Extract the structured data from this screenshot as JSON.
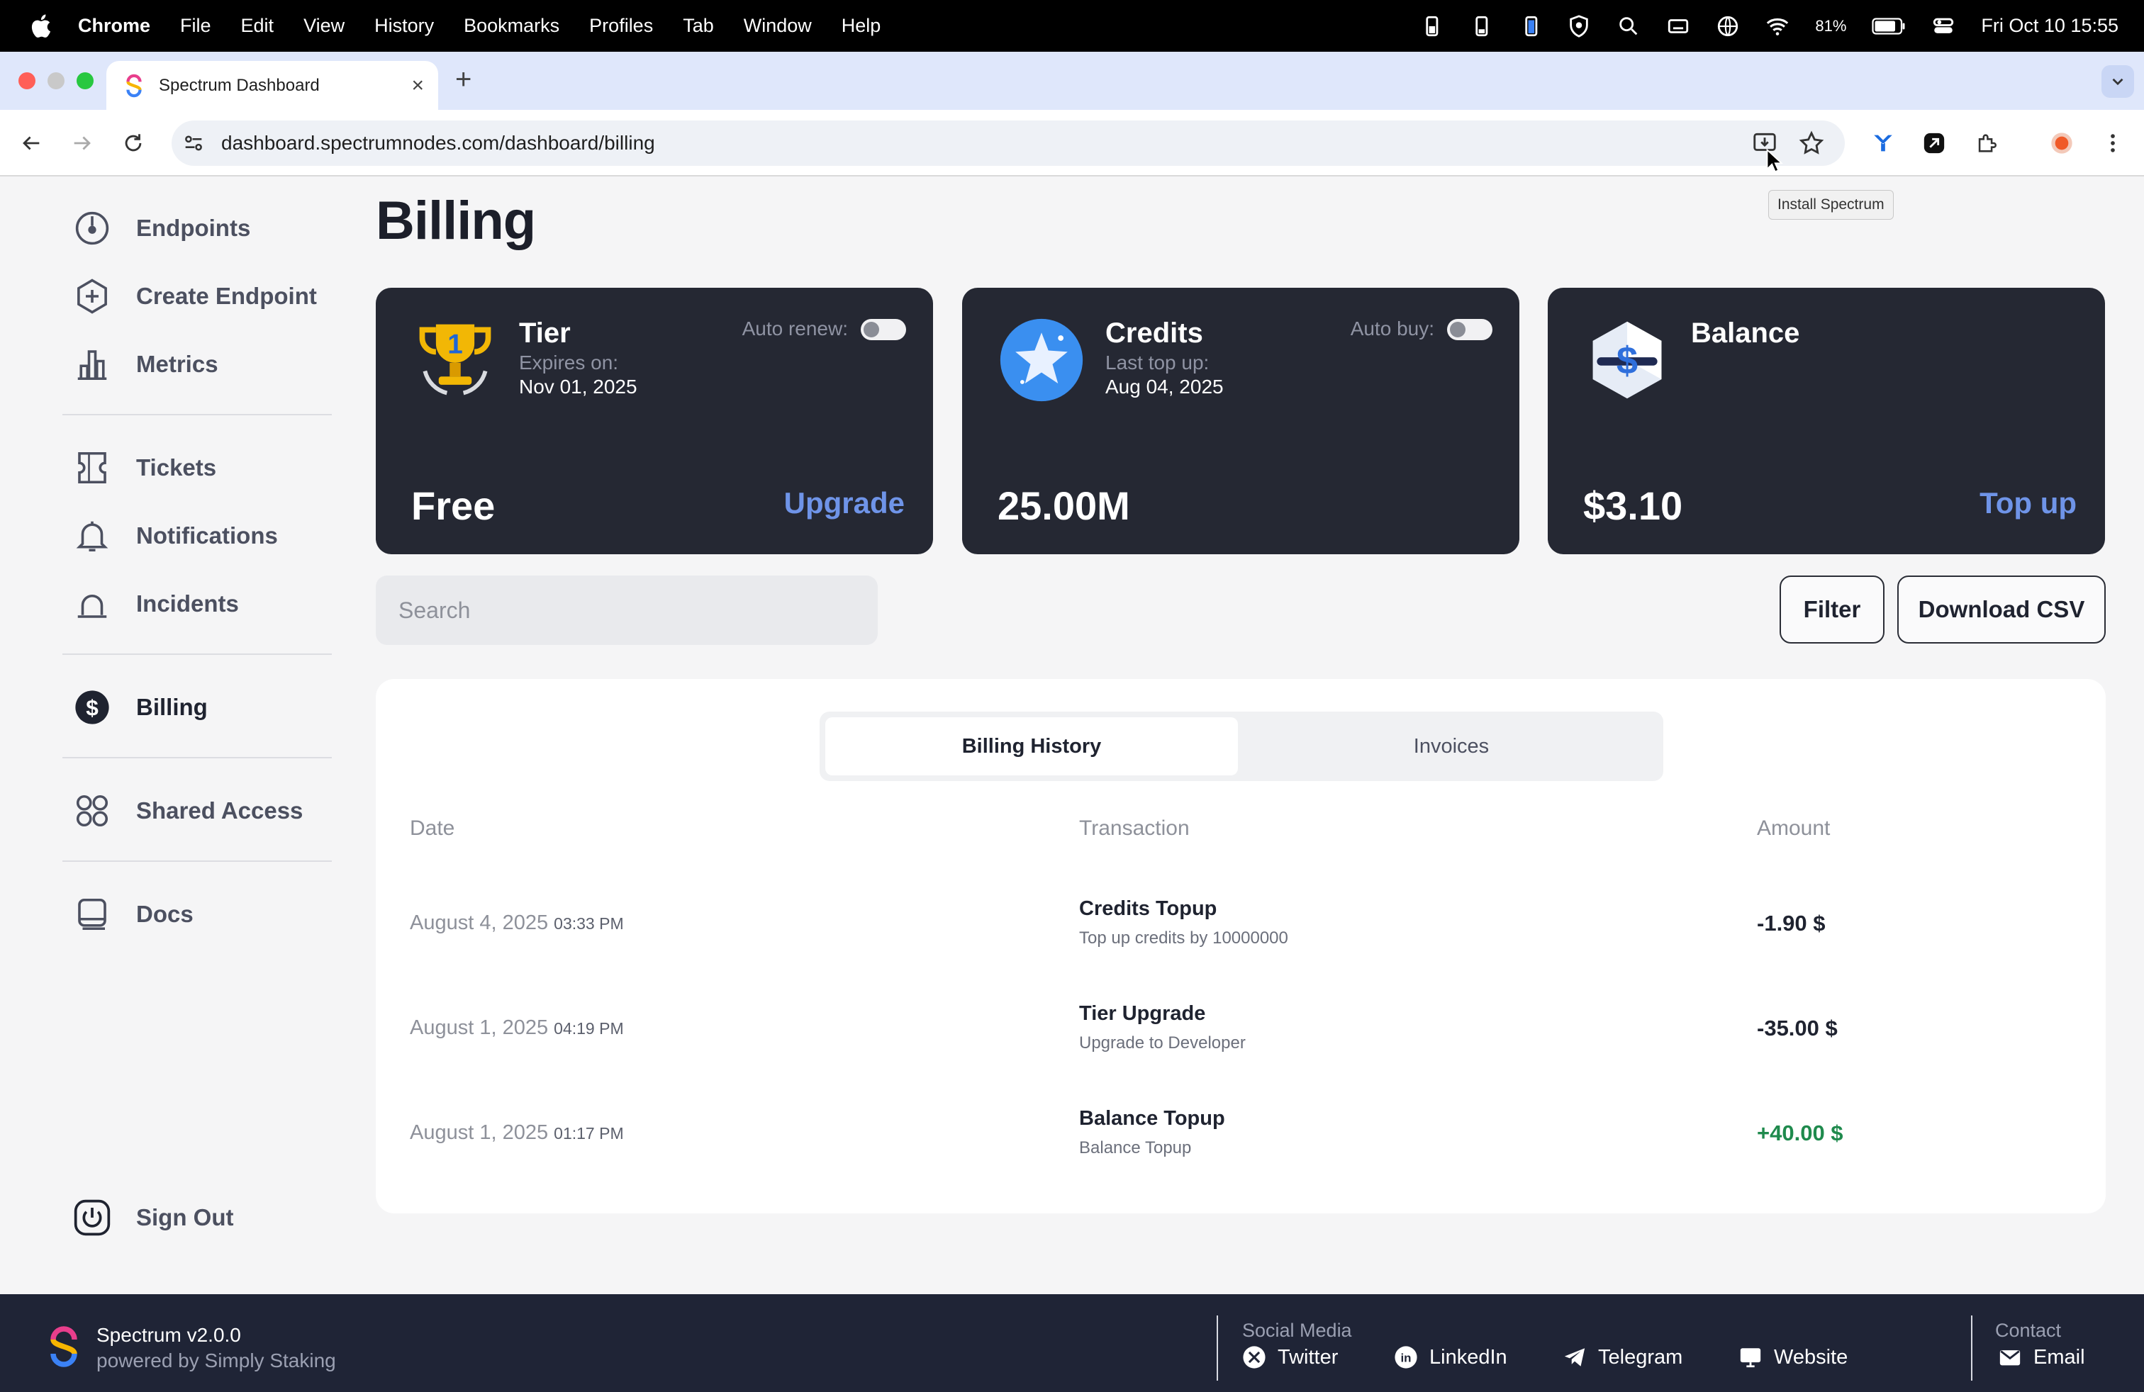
{
  "menubar": {
    "app": "Chrome",
    "items": [
      "File",
      "Edit",
      "View",
      "History",
      "Bookmarks",
      "Profiles",
      "Tab",
      "Window",
      "Help"
    ],
    "battery": "81%",
    "clock": "Fri Oct 10  15:55"
  },
  "browser": {
    "tab_title": "Spectrum Dashboard",
    "url": "dashboard.spectrumnodes.com/dashboard/billing",
    "tooltip": "Install Spectrum"
  },
  "sidebar": {
    "items": [
      {
        "label": "Endpoints",
        "icon": "gauge-icon"
      },
      {
        "label": "Create Endpoint",
        "icon": "plus-hexagon-icon"
      },
      {
        "label": "Metrics",
        "icon": "bar-chart-icon"
      },
      {
        "label": "Tickets",
        "icon": "ticket-icon"
      },
      {
        "label": "Notifications",
        "icon": "bell-icon"
      },
      {
        "label": "Incidents",
        "icon": "alarm-icon"
      },
      {
        "label": "Billing",
        "icon": "dollar-icon"
      },
      {
        "label": "Shared Access",
        "icon": "grid-circles-icon"
      },
      {
        "label": "Docs",
        "icon": "book-icon"
      }
    ],
    "signout": "Sign Out"
  },
  "page": {
    "title": "Billing"
  },
  "cards": {
    "tier": {
      "title": "Tier",
      "sub": "Expires on:",
      "date": "Nov 01, 2025",
      "toggle_label": "Auto renew:",
      "value": "Free",
      "action": "Upgrade"
    },
    "credits": {
      "title": "Credits",
      "sub": "Last top up:",
      "date": "Aug 04, 2025",
      "toggle_label": "Auto buy:",
      "value": "25.00M"
    },
    "balance": {
      "title": "Balance",
      "value": "$3.10",
      "action": "Top up"
    }
  },
  "toolbar": {
    "search_placeholder": "Search",
    "filter": "Filter",
    "download": "Download CSV"
  },
  "history": {
    "tabs": [
      "Billing History",
      "Invoices"
    ],
    "columns": [
      "Date",
      "Transaction",
      "Amount"
    ],
    "rows": [
      {
        "date": "August 4, 2025",
        "time": "03:33 PM",
        "title": "Credits Topup",
        "desc": "Top up credits by 10000000",
        "amount": "-1.90 $"
      },
      {
        "date": "August 1, 2025",
        "time": "04:19 PM",
        "title": "Tier Upgrade",
        "desc": "Upgrade to Developer",
        "amount": "-35.00 $"
      },
      {
        "date": "August 1, 2025",
        "time": "01:17 PM",
        "title": "Balance Topup",
        "desc": "Balance Topup",
        "amount": "+40.00 $"
      }
    ]
  },
  "footer": {
    "name": "Spectrum v2.0.0",
    "powered": "powered by Simply Staking",
    "social_heading": "Social Media",
    "social": [
      "Twitter",
      "LinkedIn",
      "Telegram",
      "Website"
    ],
    "contact_heading": "Contact",
    "contact": "Email"
  },
  "colors": {
    "card_bg": "#252833",
    "accent_link": "#6f94e8",
    "positive": "#1f8a4d",
    "footer_bg": "#1f2436"
  }
}
